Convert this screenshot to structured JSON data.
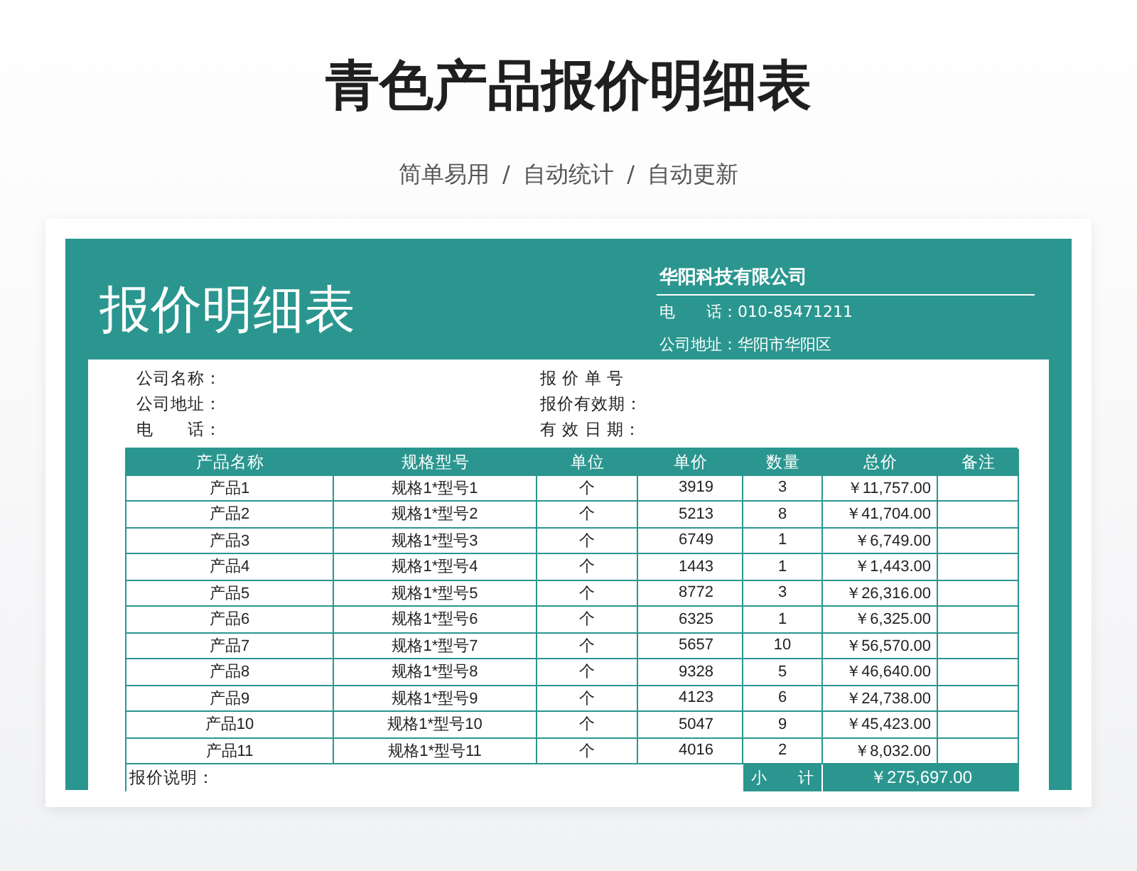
{
  "page_title": "青色产品报价明细表",
  "subtitle": "简单易用 / 自动统计 / 自动更新",
  "sheet": {
    "title": "报价明细表",
    "company": "华阳科技有限公司",
    "phone_label": "电　　话：",
    "phone": "010-85471211",
    "address_label": "公司地址：",
    "address": "华阳市华阳区"
  },
  "info_left": [
    "公司名称：",
    "公司地址：",
    "电　　话："
  ],
  "info_right": [
    "报 价 单 号",
    "报价有效期：",
    "有 效 日 期："
  ],
  "table": {
    "columns": [
      "产品名称",
      "规格型号",
      "单位",
      "单价",
      "数量",
      "总价",
      "备注"
    ],
    "rows": [
      {
        "name": "产品1",
        "spec": "规格1*型号1",
        "unit": "个",
        "price": "3919",
        "qty": "3",
        "total": "￥11,757.00"
      },
      {
        "name": "产品2",
        "spec": "规格1*型号2",
        "unit": "个",
        "price": "5213",
        "qty": "8",
        "total": "￥41,704.00"
      },
      {
        "name": "产品3",
        "spec": "规格1*型号3",
        "unit": "个",
        "price": "6749",
        "qty": "1",
        "total": "￥6,749.00"
      },
      {
        "name": "产品4",
        "spec": "规格1*型号4",
        "unit": "个",
        "price": "1443",
        "qty": "1",
        "total": "￥1,443.00"
      },
      {
        "name": "产品5",
        "spec": "规格1*型号5",
        "unit": "个",
        "price": "8772",
        "qty": "3",
        "total": "￥26,316.00"
      },
      {
        "name": "产品6",
        "spec": "规格1*型号6",
        "unit": "个",
        "price": "6325",
        "qty": "1",
        "total": "￥6,325.00"
      },
      {
        "name": "产品7",
        "spec": "规格1*型号7",
        "unit": "个",
        "price": "5657",
        "qty": "10",
        "total": "￥56,570.00"
      },
      {
        "name": "产品8",
        "spec": "规格1*型号8",
        "unit": "个",
        "price": "9328",
        "qty": "5",
        "total": "￥46,640.00"
      },
      {
        "name": "产品9",
        "spec": "规格1*型号9",
        "unit": "个",
        "price": "4123",
        "qty": "6",
        "total": "￥24,738.00"
      },
      {
        "name": "产品10",
        "spec": "规格1*型号10",
        "unit": "个",
        "price": "5047",
        "qty": "9",
        "total": "￥45,423.00"
      },
      {
        "name": "产品11",
        "spec": "规格1*型号11",
        "unit": "个",
        "price": "4016",
        "qty": "2",
        "total": "￥8,032.00"
      }
    ],
    "note_label": "报价说明：",
    "subtotal_label": "小　　计",
    "subtotal": "￥275,697.00"
  }
}
